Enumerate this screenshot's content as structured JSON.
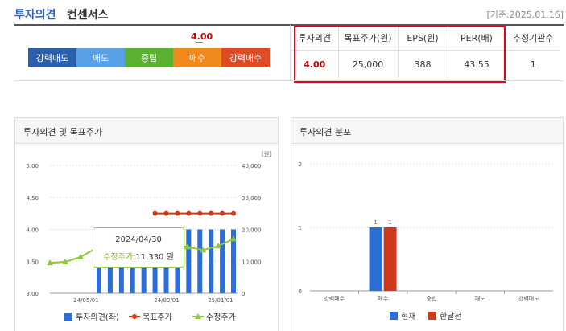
{
  "header": {
    "title_main": "투자의견",
    "title_sub": "컨센서스",
    "date": "[기준:2025.01.16]"
  },
  "opinion_scale": {
    "current_value": "4.00",
    "segments": [
      {
        "label": "강력매도",
        "color": "#2c5fab"
      },
      {
        "label": "매도",
        "color": "#5aa0e6"
      },
      {
        "label": "중립",
        "color": "#5cb031"
      },
      {
        "label": "매수",
        "color": "#f08a1c"
      },
      {
        "label": "강력매수",
        "color": "#de4a26"
      }
    ]
  },
  "consensus_table": {
    "headers": [
      "투자의견",
      "목표주가(원)",
      "EPS(원)",
      "PER(배)",
      "추정기관수"
    ],
    "row": [
      "4.00",
      "25,000",
      "388",
      "43.55",
      "1"
    ]
  },
  "chart_left": {
    "panel_title": "투자의견 및 목표주가",
    "unit_right": "[원]",
    "tooltip": {
      "date": "2024/04/30",
      "key": "수정주가",
      "value": ":11,330 원"
    },
    "legend": [
      "투자의견(좌)",
      "목표주가",
      "수정주가"
    ]
  },
  "chart_right": {
    "panel_title": "투자의견 분포",
    "legend": [
      "현재",
      "한달전"
    ]
  },
  "chart_data": [
    {
      "type": "bar",
      "title": "투자의견 및 목표주가",
      "x_ticks": [
        "24/05/01",
        "24/09/01",
        "25/01/01"
      ],
      "y_left": {
        "ticks": [
          "5.00",
          "4.50",
          "4.00",
          "3.50",
          "3.00"
        ],
        "range": [
          3.0,
          5.0
        ]
      },
      "y_right": {
        "ticks": [
          "40,000",
          "30,000",
          "20,000",
          "10,000",
          "0"
        ],
        "range": [
          0,
          40000
        ],
        "unit": "[원]"
      },
      "series": [
        {
          "name": "투자의견(좌)",
          "kind": "bar",
          "color": "#2b6fd6",
          "values": [
            4.0,
            4.0,
            4.0,
            4.0,
            4.0,
            4.0,
            4.0,
            4.0,
            4.0,
            4.0,
            4.0,
            4.0,
            4.0
          ]
        },
        {
          "name": "목표주가",
          "kind": "line",
          "color": "#cc3a1a",
          "values": [
            null,
            null,
            null,
            null,
            null,
            25000,
            25000,
            25000,
            25000,
            25000,
            25000,
            25000,
            25000
          ]
        },
        {
          "name": "수정주가",
          "kind": "line",
          "color": "#8cc63f",
          "values": [
            9500,
            9800,
            11330,
            14000,
            16000,
            18500,
            16000,
            15500,
            15000,
            14500,
            13500,
            14800,
            17000
          ]
        }
      ]
    },
    {
      "type": "bar",
      "title": "투자의견 분포",
      "categories": [
        "강력매수",
        "매수",
        "중립",
        "매도",
        "강력매도"
      ],
      "y_ticks": [
        "2",
        "1",
        "0"
      ],
      "ylim": [
        0,
        2
      ],
      "series": [
        {
          "name": "현재",
          "color": "#2b6fd6",
          "values": [
            0,
            1,
            0,
            0,
            0
          ]
        },
        {
          "name": "한달전",
          "color": "#cc3a1a",
          "values": [
            0,
            1,
            0,
            0,
            0
          ]
        }
      ]
    }
  ]
}
